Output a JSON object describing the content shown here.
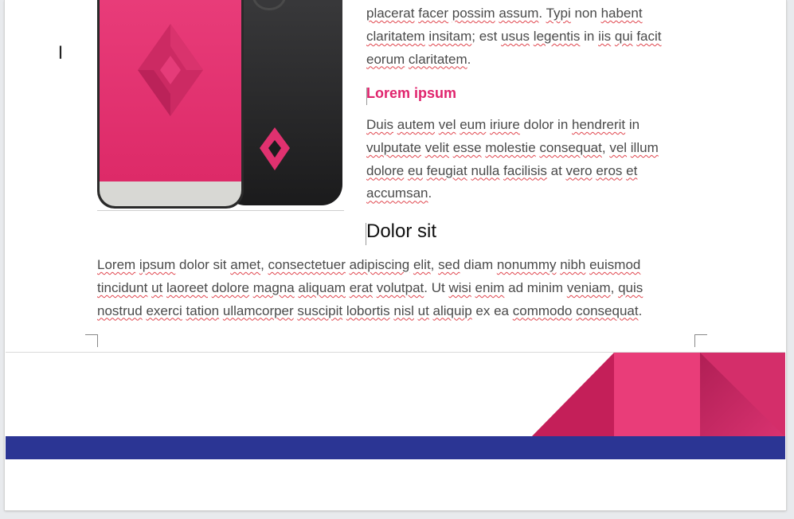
{
  "document": {
    "paragraph_top": [
      {
        "t": "placerat",
        "s": true
      },
      {
        "t": " "
      },
      {
        "t": "facer",
        "s": true
      },
      {
        "t": " "
      },
      {
        "t": "possim",
        "s": true
      },
      {
        "t": " "
      },
      {
        "t": "assum",
        "s": true
      },
      {
        "t": ". "
      },
      {
        "t": "Typi",
        "s": true
      },
      {
        "t": " non "
      },
      {
        "t": "habent",
        "s": true
      },
      {
        "t": " "
      },
      {
        "t": "claritatem",
        "s": true
      },
      {
        "t": " "
      },
      {
        "t": "insitam",
        "s": true
      },
      {
        "t": "; est "
      },
      {
        "t": "usus",
        "s": true
      },
      {
        "t": " "
      },
      {
        "t": "legentis",
        "s": true
      },
      {
        "t": " in "
      },
      {
        "t": "iis",
        "s": true
      },
      {
        "t": " "
      },
      {
        "t": "qui",
        "s": true
      },
      {
        "t": " "
      },
      {
        "t": "facit",
        "s": true
      },
      {
        "t": " "
      },
      {
        "t": "eorum",
        "s": true
      },
      {
        "t": " "
      },
      {
        "t": "claritatem",
        "s": true
      },
      {
        "t": "."
      }
    ],
    "heading_pink": "Lorem ipsum",
    "paragraph_mid": [
      {
        "t": "Duis",
        "s": true
      },
      {
        "t": " "
      },
      {
        "t": "autem",
        "s": true
      },
      {
        "t": " "
      },
      {
        "t": "vel",
        "s": true
      },
      {
        "t": " "
      },
      {
        "t": "eum",
        "s": true
      },
      {
        "t": " "
      },
      {
        "t": "iriure",
        "s": true
      },
      {
        "t": " dolor in "
      },
      {
        "t": "hendrerit",
        "s": true
      },
      {
        "t": " in "
      },
      {
        "t": "vulputate",
        "s": true
      },
      {
        "t": " "
      },
      {
        "t": "velit",
        "s": true
      },
      {
        "t": " "
      },
      {
        "t": "esse",
        "s": true
      },
      {
        "t": " "
      },
      {
        "t": "molestie",
        "s": true
      },
      {
        "t": " "
      },
      {
        "t": "consequat",
        "s": true
      },
      {
        "t": ", "
      },
      {
        "t": "vel",
        "s": true
      },
      {
        "t": " "
      },
      {
        "t": "illum",
        "s": true
      },
      {
        "t": " "
      },
      {
        "t": "dolore",
        "s": true
      },
      {
        "t": " "
      },
      {
        "t": "eu",
        "s": true
      },
      {
        "t": " "
      },
      {
        "t": "feugiat",
        "s": true
      },
      {
        "t": " "
      },
      {
        "t": "nulla",
        "s": true
      },
      {
        "t": " "
      },
      {
        "t": "facilisis",
        "s": true
      },
      {
        "t": " at "
      },
      {
        "t": "vero",
        "s": true
      },
      {
        "t": " "
      },
      {
        "t": "eros",
        "s": true
      },
      {
        "t": " "
      },
      {
        "t": "et",
        "s": true
      },
      {
        "t": " "
      },
      {
        "t": "accumsan",
        "s": true
      },
      {
        "t": "."
      }
    ],
    "heading_black": "Dolor sit",
    "paragraph_bottom": [
      {
        "t": "Lorem",
        "s": true
      },
      {
        "t": " "
      },
      {
        "t": "ipsum",
        "s": true
      },
      {
        "t": " dolor sit "
      },
      {
        "t": "amet",
        "s": true
      },
      {
        "t": ", "
      },
      {
        "t": "consectetuer",
        "s": true
      },
      {
        "t": " "
      },
      {
        "t": "adipiscing",
        "s": true
      },
      {
        "t": " "
      },
      {
        "t": "elit",
        "s": true
      },
      {
        "t": ", "
      },
      {
        "t": "sed",
        "s": true
      },
      {
        "t": " diam "
      },
      {
        "t": "nonummy",
        "s": true
      },
      {
        "t": " "
      },
      {
        "t": "nibh",
        "s": true
      },
      {
        "t": " "
      },
      {
        "t": "euismod",
        "s": true
      },
      {
        "t": " "
      },
      {
        "t": "tincidunt",
        "s": true
      },
      {
        "t": " "
      },
      {
        "t": "ut",
        "s": true
      },
      {
        "t": " "
      },
      {
        "t": "laoreet",
        "s": true
      },
      {
        "t": " "
      },
      {
        "t": "dolore",
        "s": true
      },
      {
        "t": " "
      },
      {
        "t": "magna",
        "s": true
      },
      {
        "t": " "
      },
      {
        "t": "aliquam",
        "s": true
      },
      {
        "t": " "
      },
      {
        "t": "erat",
        "s": true
      },
      {
        "t": " "
      },
      {
        "t": "volutpat",
        "s": true
      },
      {
        "t": ". Ut "
      },
      {
        "t": "wisi",
        "s": true
      },
      {
        "t": " "
      },
      {
        "t": "enim",
        "s": true
      },
      {
        "t": " ad minim "
      },
      {
        "t": "veniam",
        "s": true
      },
      {
        "t": ", "
      },
      {
        "t": "quis",
        "s": true
      },
      {
        "t": " "
      },
      {
        "t": "nostrud",
        "s": true
      },
      {
        "t": " "
      },
      {
        "t": "exerci",
        "s": true
      },
      {
        "t": " "
      },
      {
        "t": "tation",
        "s": true
      },
      {
        "t": " "
      },
      {
        "t": "ullamcorper",
        "s": true
      },
      {
        "t": " "
      },
      {
        "t": "suscipit",
        "s": true
      },
      {
        "t": " "
      },
      {
        "t": "lobortis",
        "s": true
      },
      {
        "t": " "
      },
      {
        "t": "nisl",
        "s": true
      },
      {
        "t": " "
      },
      {
        "t": "ut",
        "s": true
      },
      {
        "t": " "
      },
      {
        "t": "aliquip",
        "s": true
      },
      {
        "t": " ex ea "
      },
      {
        "t": "commodo",
        "s": true
      },
      {
        "t": " "
      },
      {
        "t": "consequat",
        "s": true
      },
      {
        "t": "."
      }
    ]
  },
  "icons": {
    "mouse_cursor": "text-cursor-icon",
    "phone_logo": "diamond-logo-icon"
  },
  "colors": {
    "accent_pink": "#e0246d",
    "footer_blue": "#2b3594",
    "spellcheck_red": "#e0454d"
  }
}
